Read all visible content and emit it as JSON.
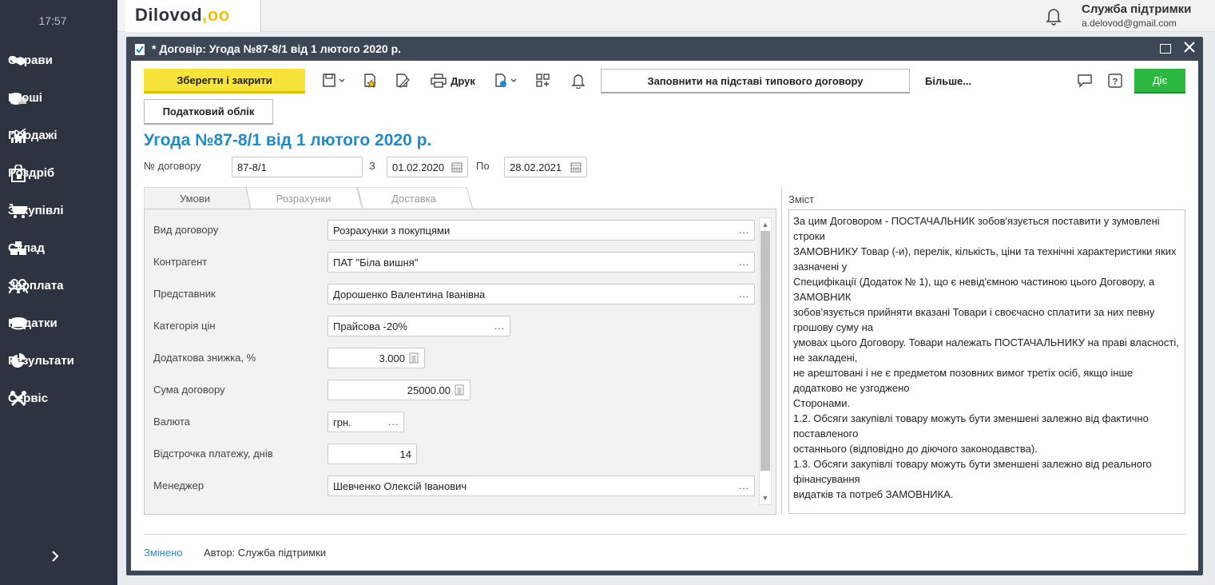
{
  "clock": "17:57",
  "sidebar": {
    "items": [
      {
        "label": "Справи",
        "icon": "handshake-icon"
      },
      {
        "label": "Гроші",
        "icon": "coins-icon"
      },
      {
        "label": "Продажі",
        "icon": "chart-icon"
      },
      {
        "label": "Роздріб",
        "icon": "shopping-bag-icon"
      },
      {
        "label": "Закупівлі",
        "icon": "cart-icon"
      },
      {
        "label": "Склад",
        "icon": "boxes-icon"
      },
      {
        "label": "Зарплата",
        "icon": "people-icon"
      },
      {
        "label": "Податки",
        "icon": "officer-cap-icon"
      },
      {
        "label": "Результати",
        "icon": "pie-chart-icon"
      },
      {
        "label": "Сервіс",
        "icon": "tools-icon"
      }
    ],
    "expand_icon": "chevron-right-icon"
  },
  "topbar": {
    "logo_text": "Dilovod",
    "logo_dots": ",oo",
    "user_name": "Служба підтримки",
    "user_email": "a.delovod@gmail.com"
  },
  "window": {
    "title": "* Договір: Угода №87-8/1 від 1 лютого 2020 р."
  },
  "toolbar": {
    "save_close": "Зберегти і закрити",
    "print": "Друк",
    "fill_template": "Заповнити на підставі типового договору",
    "more": "Більше...",
    "action": "Діє",
    "tax_accounting": "Податковий облік"
  },
  "doc": {
    "heading": "Угода №87-8/1 від 1 лютого 2020 р.",
    "number_label": "№ договору",
    "number": "87-8/1",
    "from_label": "З",
    "from_date": "01.02.2020",
    "to_label": "По",
    "to_date": "28.02.2021"
  },
  "tabs": [
    "Умови",
    "Розрахунки",
    "Доставка"
  ],
  "fields": {
    "contract_type": {
      "label": "Вид договору",
      "value": "Розрахунки з покупцями"
    },
    "counterparty": {
      "label": "Контрагент",
      "value": "ПАТ \"Біла вишня\""
    },
    "representative": {
      "label": "Представник",
      "value": "Дорошенко Валентина Іванівна"
    },
    "price_category": {
      "label": "Категорія цін",
      "value": "Прайсова -20%"
    },
    "extra_discount": {
      "label": "Додаткова знижка, %",
      "value": "3.000"
    },
    "contract_sum": {
      "label": "Сума договору",
      "value": "25000.00"
    },
    "currency": {
      "label": "Валюта",
      "value": "грн."
    },
    "payment_delay": {
      "label": "Відстрочка платежу, днів",
      "value": "14"
    },
    "manager": {
      "label": "Менеджер",
      "value": "Шевченко Олексій Іванович"
    }
  },
  "content": {
    "label": "Зміст",
    "text": "За цим Договором - ПОСТАЧАЛЬНИК зобов'язується поставити у зумовлені строки\nЗАМОВНИКУ Товар (-и), перелік, кількість, ціни та технічні характеристики яких зазначені у\nСпецифікації (Додаток № 1), що є невід'ємною частиною цього Договору, а ЗАМОВНИК\nзобов'язується прийняти вказані Товари і своєчасно сплатити за них певну грошову суму на\nумовах цього Договору. Товари належать ПОСТАЧАЛЬНИКУ на праві власності, не закладені,\nне арештовані і не є предметом позовних вимог третіх осіб, якщо інше додатково не узгоджено\nСторонами.\n1.2. Обсяги закупівлі товару можуть бути зменшені залежно від фактично поставленого\nостаннього (відповідно до діючого законодавства).\n1.3. Обсяги закупівлі товару можуть бути зменшені залежно від реального фінансування\nвидатків та потреб ЗАМОВНИКА."
  },
  "status": {
    "changed": "Змінено",
    "author": "Автор: Служба підтримки"
  },
  "colors": {
    "sidebar_bg": "#2d3440",
    "accent_blue": "#1f8bc8",
    "primary_yellow": "#f7e33a",
    "action_green": "#2cb741"
  }
}
